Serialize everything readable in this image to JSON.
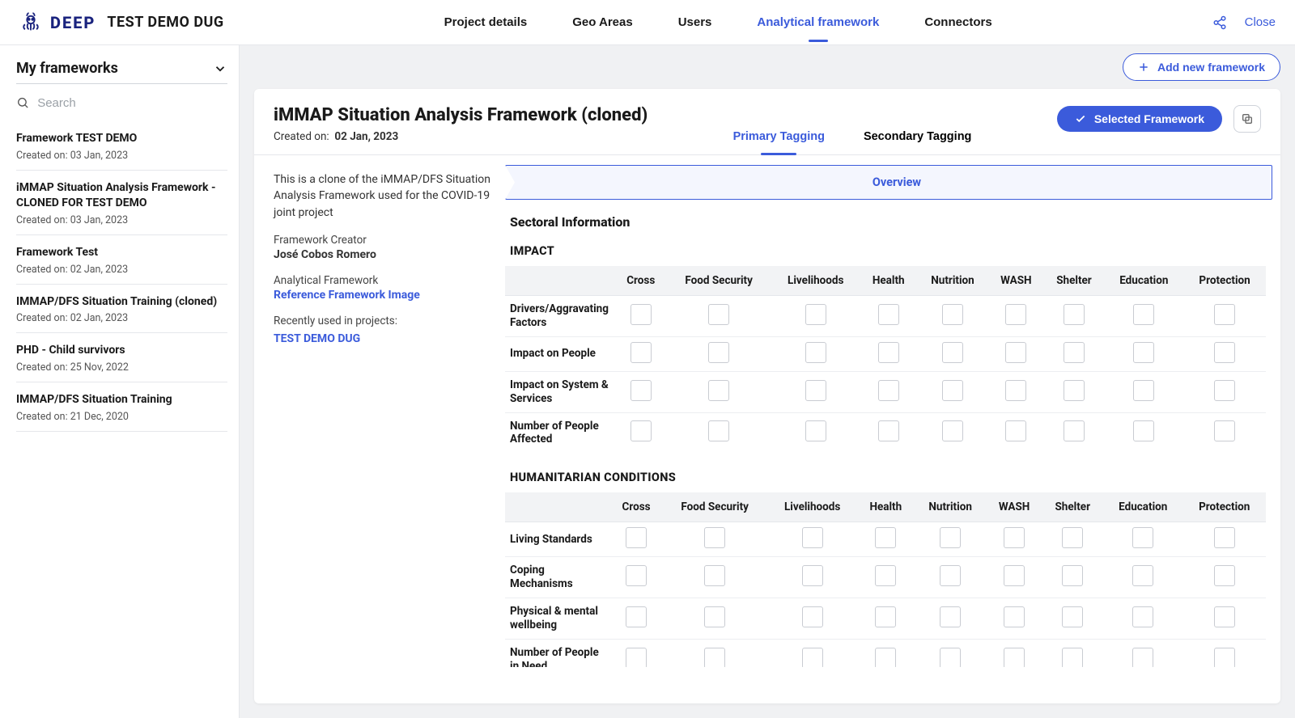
{
  "brand": {
    "name": "DEEP",
    "project": "TEST DEMO DUG"
  },
  "topnav": {
    "items": [
      {
        "label": "Project details"
      },
      {
        "label": "Geo Areas"
      },
      {
        "label": "Users"
      },
      {
        "label": "Analytical framework",
        "active": true
      },
      {
        "label": "Connectors"
      }
    ],
    "close": "Close"
  },
  "toolbar": {
    "add_label": "Add new framework"
  },
  "sidebar": {
    "title": "My frameworks",
    "search_placeholder": "Search",
    "created_on_label": "Created on:",
    "items": [
      {
        "name": "Framework TEST DEMO",
        "created": "03 Jan, 2023"
      },
      {
        "name": "iMMAP Situation Analysis Framework - CLONED FOR TEST DEMO",
        "created": "03 Jan, 2023"
      },
      {
        "name": "Framework Test",
        "created": "02 Jan, 2023"
      },
      {
        "name": "IMMAP/DFS Situation Training (cloned)",
        "created": "02 Jan, 2023"
      },
      {
        "name": "PHD - Child survivors",
        "created": "25 Nov, 2022"
      },
      {
        "name": "IMMAP/DFS Situation Training",
        "created": "21 Dec, 2020"
      }
    ]
  },
  "framework": {
    "title": "iMMAP Situation Analysis Framework (cloned)",
    "created_on_label": "Created on:",
    "created_on": "02 Jan, 2023",
    "tabs": {
      "primary": "Primary Tagging",
      "secondary": "Secondary Tagging"
    },
    "selected_btn": "Selected Framework",
    "description": "This is a clone of the iMMAP/DFS Situation Analysis Framework used for the COVID-19 joint project",
    "creator_label": "Framework Creator",
    "creator": "José Cobos Romero",
    "af_label": "Analytical Framework",
    "af_link": "Reference Framework Image",
    "recent_label": "Recently used in projects:",
    "recent_project": "TEST DEMO DUG",
    "overview_label": "Overview",
    "section_title": "Sectoral Information",
    "groups": [
      {
        "title": "IMPACT",
        "columns": [
          "Cross",
          "Food Security",
          "Livelihoods",
          "Health",
          "Nutrition",
          "WASH",
          "Shelter",
          "Education",
          "Protection"
        ],
        "rows": [
          "Drivers/Aggravating Factors",
          "Impact on People",
          "Impact on System & Services",
          "Number of People Affected"
        ]
      },
      {
        "title": "HUMANITARIAN CONDITIONS",
        "columns": [
          "Cross",
          "Food Security",
          "Livelihoods",
          "Health",
          "Nutrition",
          "WASH",
          "Shelter",
          "Education",
          "Protection"
        ],
        "rows": [
          "Living Standards",
          "Coping Mechanisms",
          "Physical & mental wellbeing",
          "Number of People in Need"
        ]
      }
    ]
  }
}
